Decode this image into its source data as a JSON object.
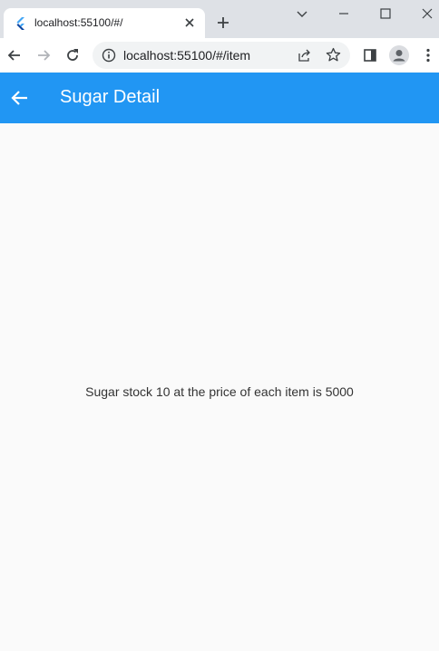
{
  "browser": {
    "tab": {
      "title": "localhost:55100/#/",
      "favicon": "flutter-icon"
    },
    "address_bar": {
      "url": "localhost:55100/#/item"
    },
    "icons": {
      "back": "back-arrow-icon",
      "forward": "forward-arrow-icon",
      "reload": "reload-icon",
      "info": "info-icon",
      "share": "share-icon",
      "bookmark": "star-icon",
      "side_panel": "side-panel-icon",
      "profile": "profile-icon",
      "menu": "kebab-menu-icon"
    }
  },
  "app": {
    "title": "Sugar Detail",
    "accent_color": "#2196f3",
    "message": "Sugar stock 10 at the price of each item is 5000"
  }
}
